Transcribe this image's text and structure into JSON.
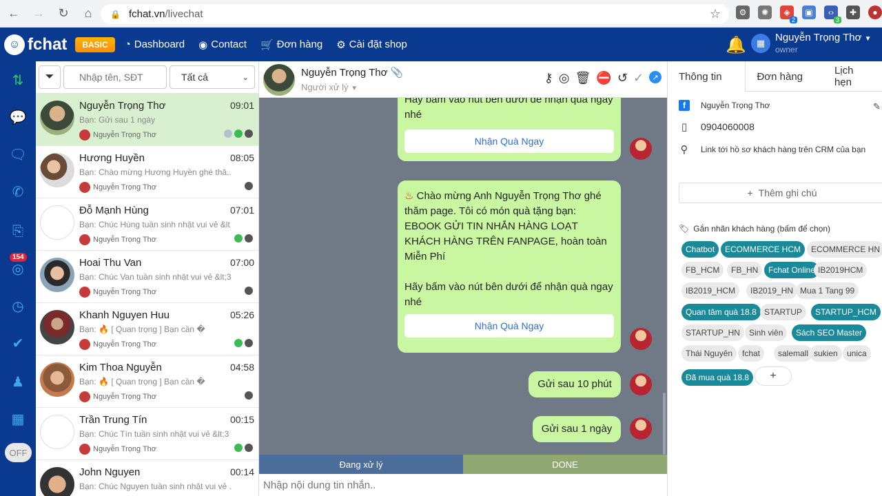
{
  "browser": {
    "url_host": "fchat.vn",
    "url_path": "/livechat",
    "ext_badge_1": "2",
    "ext_badge_2": "3"
  },
  "header": {
    "logo": "fchat",
    "plan": "BASIC",
    "nav": [
      {
        "label": "Dashboard",
        "icon": "dashboard-icon"
      },
      {
        "label": "Contact",
        "icon": "user-icon"
      },
      {
        "label": "Đơn hàng",
        "icon": "cart-icon"
      },
      {
        "label": "Cài đặt shop",
        "icon": "gear-icon"
      }
    ],
    "user_name": "Nguyễn Trọng Thơ",
    "user_role": "owner",
    "colors": {
      "bar": "#0a3a8f",
      "bell": "#3ddc3d"
    }
  },
  "rail": {
    "badge": "154",
    "toggle": "OFF"
  },
  "list": {
    "search_placeholder": "Nhập tên, SĐT",
    "filter_value": "Tất cả",
    "conversations": [
      {
        "name": "Nguyễn Trọng Thơ",
        "time": "09:01",
        "preview": "Bạn: Gửi sau 1 ngày",
        "agent": "Nguyễn Trọng Thơ"
      },
      {
        "name": "Hương Huyền",
        "time": "08:05",
        "preview": "Bạn: Chào mừng Hương Huyền ghé thă...",
        "agent": "Nguyễn Trọng Thơ"
      },
      {
        "name": "Đỗ Mạnh Hùng",
        "time": "07:01",
        "preview": "Bạn: Chúc Hùng tuần sinh nhật vui vẻ &lt;3",
        "agent": "Nguyễn Trọng Thơ"
      },
      {
        "name": "Hoai Thu Van",
        "time": "07:00",
        "preview": "Bạn: Chúc Van tuần sinh nhật vui vẻ &lt;3",
        "agent": "Nguyễn Trọng Thơ"
      },
      {
        "name": "Khanh Nguyen Huu",
        "time": "05:26",
        "preview_prefix": "Bạn:",
        "preview": "[ Quan trọng ] Bạn cần �",
        "agent": "Nguyễn Trọng Thơ"
      },
      {
        "name": "Kim Thoa Nguyễn",
        "time": "04:58",
        "preview_prefix": "Bạn:",
        "preview": "[ Quan trọng ] Bạn cần �",
        "agent": "Nguyễn Trọng Thơ"
      },
      {
        "name": "Trần Trung Tín",
        "time": "00:15",
        "preview": "Bạn: Chúc Tín tuần sinh nhật vui vẻ &lt;3",
        "agent": "Nguyễn Trọng Thơ"
      },
      {
        "name": "John Nguyen",
        "time": "00:14",
        "preview": "Bạn: Chúc Nguyen tuần sinh nhật vui vẻ ...",
        "agent": "Nguyễn Trọng Thơ"
      }
    ]
  },
  "chat": {
    "name": "Nguyễn Trọng Thơ",
    "handler": "Người xử lý",
    "messages": [
      {
        "text_top": "Hãy bấm vào nút bên dưới để nhận quà ngay nhé",
        "button": "Nhận Quà Ngay"
      },
      {
        "text": "Chào mừng Anh Nguyễn Trọng Thơ ghé thăm page. Tôi có món quà tặng bạn: EBOOK GỬI TIN NHẮN HÀNG LOẠT KHÁCH HÀNG TRÊN FANPAGE, hoàn toàn Miễn Phí",
        "text2": "Hãy bấm vào nút bên dưới để nhận quà ngay nhé",
        "button": "Nhận Quà Ngay"
      },
      {
        "text": "Gửi sau 10 phút"
      },
      {
        "text": "Gửi sau 1 ngày"
      }
    ],
    "status_processing": "Đang xử lý",
    "status_done": "DONE",
    "input_placeholder": "Nhập nội dung tin nhắn.."
  },
  "info": {
    "tabs": [
      "Thông tin",
      "Đơn hàng",
      "Lịch hẹn"
    ],
    "fb_name": "Nguyễn Trọng Thơ",
    "phone": "0904060008",
    "crm_link": "Link tới hồ sơ khách hàng trên CRM của bạn",
    "add_note": "Thêm ghi chú",
    "tag_title": "Gắn nhãn khách hàng (bấm để chọn)",
    "tags": [
      {
        "label": "Chatbot",
        "on": true
      },
      {
        "label": "ECOMMERCE HCM",
        "on": true
      },
      {
        "label": "ECOMMERCE HN",
        "on": false
      },
      {
        "label": "FB_HCM",
        "on": false
      },
      {
        "label": "FB_HN",
        "on": false
      },
      {
        "label": "Fchat Online",
        "on": true
      },
      {
        "label": "IB2019HCM",
        "on": false
      },
      {
        "label": "IB2019_HCM",
        "on": false
      },
      {
        "label": "IB2019_HN",
        "on": false
      },
      {
        "label": "Mua 1 Tang 99",
        "on": false
      },
      {
        "label": "Quan tâm quà 18.8",
        "on": true
      },
      {
        "label": "STARTUP",
        "on": false
      },
      {
        "label": "STARTUP_HCM",
        "on": true
      },
      {
        "label": "STARTUP_HN",
        "on": false
      },
      {
        "label": "Sinh viên",
        "on": false
      },
      {
        "label": "Sách SEO Master",
        "on": true
      },
      {
        "label": "Thái Nguyên",
        "on": false
      },
      {
        "label": "fchat",
        "on": false
      },
      {
        "label": "salemall",
        "on": false
      },
      {
        "label": "sukien",
        "on": false
      },
      {
        "label": "unica",
        "on": false
      },
      {
        "label": "Đã mua quà 18.8",
        "on": true
      },
      {
        "label": "+",
        "on": false
      }
    ]
  }
}
